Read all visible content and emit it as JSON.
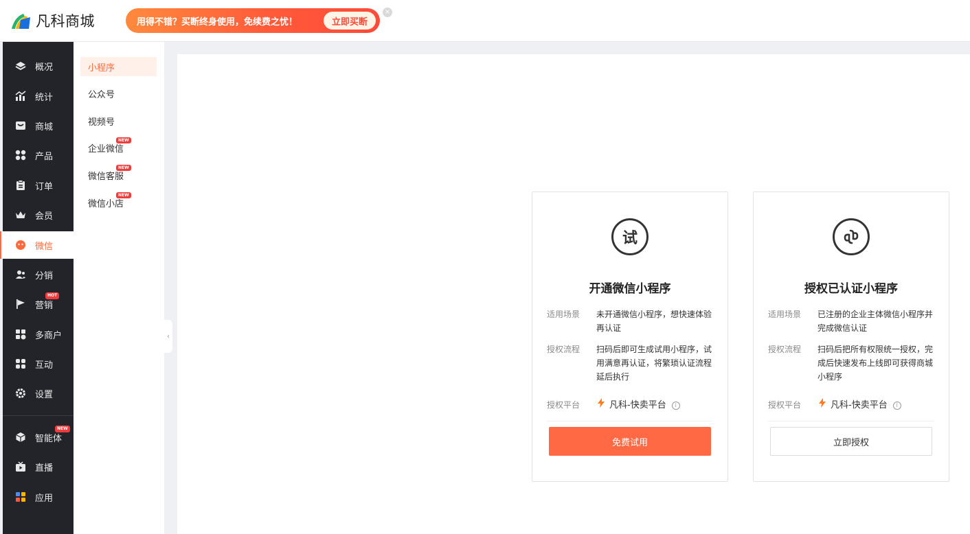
{
  "header": {
    "logo_text": "凡科商城",
    "promo_text": "用得不错？买断终身使用，免续费之忧！",
    "promo_cta": "立即买断",
    "close_glyph": "×"
  },
  "sidebar": {
    "items": [
      {
        "label": "概况",
        "icon": "layers-icon"
      },
      {
        "label": "统计",
        "icon": "chart-icon"
      },
      {
        "label": "商城",
        "icon": "store-icon"
      },
      {
        "label": "产品",
        "icon": "grid-icon"
      },
      {
        "label": "订单",
        "icon": "clipboard-icon"
      },
      {
        "label": "会员",
        "icon": "crown-icon"
      },
      {
        "label": "微信",
        "icon": "wechat-icon"
      },
      {
        "label": "分销",
        "icon": "users-icon"
      },
      {
        "label": "营销",
        "icon": "flag-icon",
        "badge": "HOT"
      },
      {
        "label": "多商户",
        "icon": "multi-store-icon"
      },
      {
        "label": "互动",
        "icon": "interact-icon"
      },
      {
        "label": "设置",
        "icon": "gear-icon"
      },
      {
        "label": "智能体",
        "icon": "cube-icon",
        "badge": "NEW"
      },
      {
        "label": "直播",
        "icon": "tv-icon"
      },
      {
        "label": "应用",
        "icon": "apps-icon"
      }
    ]
  },
  "subnav": {
    "items": [
      {
        "label": "小程序"
      },
      {
        "label": "公众号"
      },
      {
        "label": "视频号"
      },
      {
        "label": "企业微信",
        "badge": "NEW"
      },
      {
        "label": "微信客服",
        "badge": "NEW"
      },
      {
        "label": "微信小店",
        "badge": "NEW"
      }
    ],
    "collapse_glyph": "‹"
  },
  "cards": [
    {
      "icon_text": "试",
      "title": "开通微信小程序",
      "scene_label": "适用场景",
      "scene_value": "未开通微信小程序，想快速体验再认证",
      "flow_label": "授权流程",
      "flow_value": "扫码后即可生成试用小程序，试用满意再认证，将繁琐认证流程延后执行",
      "platform_label": "授权平台",
      "platform_value": "凡科-快卖平台",
      "info_glyph": "i",
      "button_label": "免费试用"
    },
    {
      "title": "授权已认证小程序",
      "scene_label": "适用场景",
      "scene_value": "已注册的企业主体微信小程序并完成微信认证",
      "flow_label": "授权流程",
      "flow_value": "扫码后把所有权限统一授权，完成后快速发布上线即可获得商城小程序",
      "platform_label": "授权平台",
      "platform_value": "凡科-快卖平台",
      "info_glyph": "i",
      "button_label": "立即授权"
    }
  ],
  "colors": {
    "accent": "#ff6a3d",
    "sidebar_bg": "#222429",
    "badge_red": "#f23c3c"
  }
}
